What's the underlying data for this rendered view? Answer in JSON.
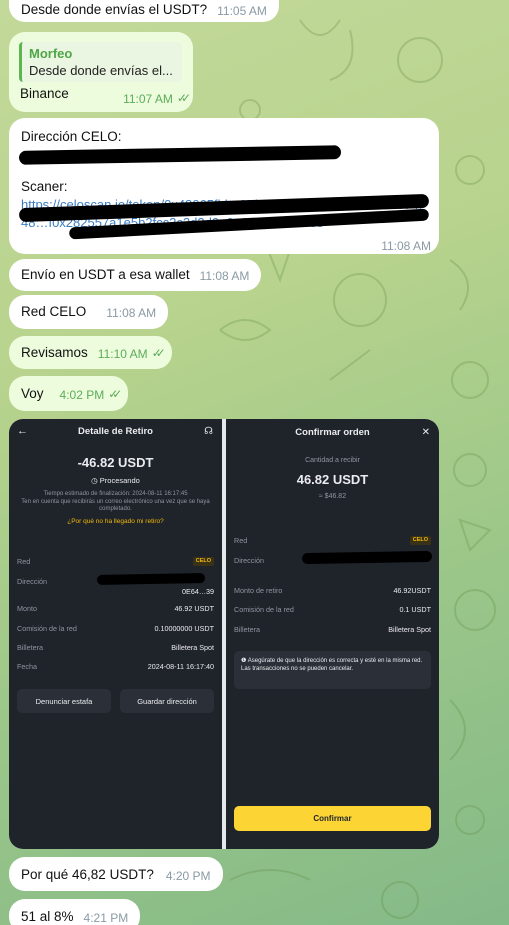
{
  "messages": [
    {
      "text": "Desde donde envías el USDT?",
      "time": "11:05 AM"
    },
    {
      "reply_name": "Morfeo",
      "reply_text": "Desde donde envías el...",
      "text": "Binance",
      "time": "11:07 AM",
      "ticks": "✓✓"
    },
    {
      "label1": "Dirección CELO:",
      "label2": "Scaner:",
      "link": "https://celoscan.io/token/0x48065fbbe25f71c9282ddf5e1cd6d6a887483d5e?a=0xE64b…",
      "link2": "48…f0x282557a1e5b2fcc2c2d2d0e6a8e1f0e448835",
      "time": "11:08 AM"
    },
    {
      "text": "Envío en USDT a esa wallet",
      "time": "11:08 AM"
    },
    {
      "text": "Red CELO",
      "time": "11:08 AM"
    },
    {
      "text": "Revisamos",
      "time": "11:10 AM",
      "ticks": "✓✓"
    },
    {
      "text": "Voy",
      "time": "4:02 PM",
      "ticks": "✓✓"
    },
    {
      "text": "Por qué 46,82 USDT?",
      "time": "4:20 PM"
    },
    {
      "text": "51 al 8%",
      "time": "4:21 PM"
    }
  ],
  "screenshot": {
    "left": {
      "title": "Detalle de Retiro",
      "amount": "-46.82 USDT",
      "status": "Procesando",
      "eta": "Tiempo estimado de finalización: 2024-08-11 16:17:45",
      "notice": "Ten en cuenta que recibirás un correo electrónico una vez que se haya completado.",
      "why_link": "¿Por qué no ha llegado mi retiro?",
      "rows": [
        {
          "k": "Red",
          "v": "CELO"
        },
        {
          "k": "Dirección",
          "v": "0E64…39"
        },
        {
          "k": "Monto",
          "v": "46.92 USDT"
        },
        {
          "k": "Comisión de la red",
          "v": "0.10000000 USDT"
        },
        {
          "k": "Billetera",
          "v": "Billetera Spot"
        },
        {
          "k": "Fecha",
          "v": "2024-08-11 16:17:40"
        }
      ],
      "btn_report": "Denunciar estafa",
      "btn_save": "Guardar dirección"
    },
    "right": {
      "title": "Confirmar orden",
      "receive_label": "Cantidad a recibir",
      "receive_amount": "46.82 USDT",
      "receive_usd": "≈ $46.82",
      "rows": [
        {
          "k": "Red",
          "v": "CELO"
        },
        {
          "k": "Dirección",
          "v": ""
        },
        {
          "k": "Monto de retiro",
          "v": "46.92USDT"
        },
        {
          "k": "Comisión de la red",
          "v": "0.1 USDT"
        },
        {
          "k": "Billetera",
          "v": "Billetera Spot"
        }
      ],
      "warn1": "Asegúrate de que la dirección es correcta y esté en la misma red.",
      "warn2": "Las transacciones no se pueden cancelar.",
      "confirm": "Confirmar"
    }
  }
}
